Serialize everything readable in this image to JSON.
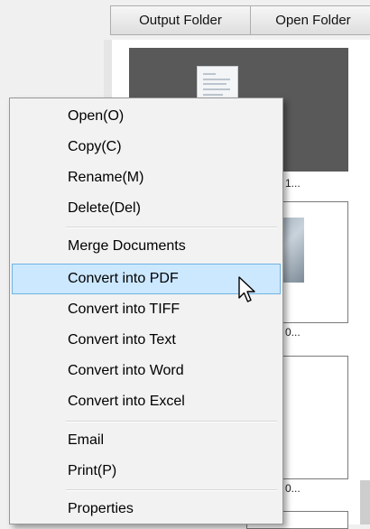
{
  "toolbar": {
    "output_folder_label": "Output Folder",
    "open_folder_label": "Open Folder"
  },
  "thumbnails": {
    "captions": [
      "1...",
      "0...",
      "0..."
    ]
  },
  "context_menu": {
    "items": [
      {
        "label": "Open(O)"
      },
      {
        "label": "Copy(C)"
      },
      {
        "label": "Rename(M)"
      },
      {
        "label": "Delete(Del)"
      },
      {
        "label": "Merge Documents"
      },
      {
        "label": "Convert into PDF",
        "highlighted": true
      },
      {
        "label": "Convert into TIFF"
      },
      {
        "label": "Convert into Text"
      },
      {
        "label": "Convert into Word"
      },
      {
        "label": "Convert into Excel"
      },
      {
        "label": "Email"
      },
      {
        "label": "Print(P)"
      },
      {
        "label": "Properties"
      }
    ]
  },
  "colors": {
    "highlight_fill": "#cce8ff",
    "highlight_border": "#6fb3e3",
    "menu_background": "#f2f2f2"
  }
}
